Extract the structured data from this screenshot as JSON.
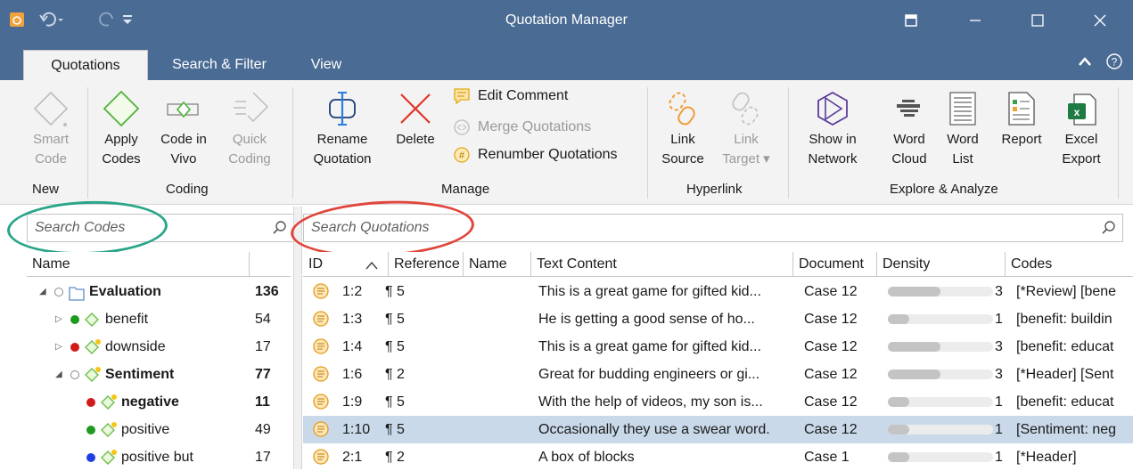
{
  "window": {
    "title": "Quotation Manager"
  },
  "tabs": [
    "Quotations",
    "Search & Filter",
    "View"
  ],
  "ribbon": {
    "new": {
      "group": "New",
      "smart_code": [
        "Smart",
        "Code"
      ]
    },
    "coding": {
      "group": "Coding",
      "apply_codes": [
        "Apply",
        "Codes"
      ],
      "code_in_vivo": [
        "Code in",
        "Vivo"
      ],
      "quick_coding": [
        "Quick",
        "Coding"
      ]
    },
    "manage": {
      "group": "Manage",
      "rename": [
        "Rename",
        "Quotation"
      ],
      "delete": "Delete",
      "edit_comment": "Edit Comment",
      "merge": "Merge Quotations",
      "renumber": "Renumber Quotations"
    },
    "hyperlink": {
      "group": "Hyperlink",
      "link_source": [
        "Link",
        "Source"
      ],
      "link_target": [
        "Link",
        "Target ▾"
      ]
    },
    "explore": {
      "group": "Explore & Analyze",
      "show_network": [
        "Show in",
        "Network"
      ],
      "word_cloud": [
        "Word",
        "Cloud"
      ],
      "word_list": [
        "Word",
        "List"
      ],
      "report": "Report",
      "excel_export": [
        "Excel",
        "Export"
      ]
    }
  },
  "search_codes": {
    "placeholder": "Search Codes"
  },
  "search_quotations": {
    "placeholder": "Search Quotations"
  },
  "codes_table": {
    "header": {
      "name": "Name"
    },
    "rows": [
      {
        "name": "Evaluation",
        "count": "136",
        "bold": true,
        "dot": "",
        "kind": "folder",
        "expander": "◢",
        "indent": 0
      },
      {
        "name": "benefit",
        "count": "54",
        "bold": false,
        "dot": "#1e9a1e",
        "kind": "code",
        "expander": "▷",
        "indent": 1
      },
      {
        "name": "downside",
        "count": "17",
        "bold": false,
        "dot": "#d11a1a",
        "kind": "code-star",
        "expander": "▷",
        "indent": 1
      },
      {
        "name": "Sentiment",
        "count": "77",
        "bold": true,
        "dot": "",
        "kind": "code-star",
        "expander": "◢",
        "indent": 1
      },
      {
        "name": "negative",
        "count": "11",
        "bold": true,
        "dot": "#d11a1a",
        "kind": "code-star",
        "expander": "",
        "indent": 2
      },
      {
        "name": "positive",
        "count": "49",
        "bold": false,
        "dot": "#1e9a1e",
        "kind": "code-star",
        "expander": "",
        "indent": 2
      },
      {
        "name": "positive but",
        "count": "17",
        "bold": false,
        "dot": "#1f3fe0",
        "kind": "code-star",
        "expander": "",
        "indent": 2
      }
    ]
  },
  "quotations_table": {
    "header": {
      "id": "ID",
      "reference": "Reference",
      "name": "Name",
      "text": "Text Content",
      "document": "Document",
      "density": "Density",
      "codes": "Codes"
    },
    "rows": [
      {
        "id": "1:2",
        "ref": "¶ 5",
        "text": "This is a great game for gifted kid...",
        "doc": "Case 12",
        "density": 3,
        "codes": "[*Review] [bene"
      },
      {
        "id": "1:3",
        "ref": "¶ 5",
        "text": "He is getting a good sense of ho...",
        "doc": "Case 12",
        "density": 1,
        "codes": "[benefit: buildin"
      },
      {
        "id": "1:4",
        "ref": "¶ 5",
        "text": "This is a great game for gifted kid...",
        "doc": "Case 12",
        "density": 3,
        "codes": "[benefit: educat"
      },
      {
        "id": "1:6",
        "ref": "¶ 2",
        "text": "Great for budding engineers or gi...",
        "doc": "Case 12",
        "density": 3,
        "codes": "[*Header] [Sent"
      },
      {
        "id": "1:9",
        "ref": "¶ 5",
        "text": "With the help of videos, my son is...",
        "doc": "Case 12",
        "density": 1,
        "codes": "[benefit: educat"
      },
      {
        "id": "1:10",
        "ref": "¶ 5",
        "text": "Occasionally they use a swear word.",
        "doc": "Case 12",
        "density": 1,
        "codes": "[Sentiment: neg",
        "selected": true
      },
      {
        "id": "2:1",
        "ref": "¶ 2",
        "text": "A box of blocks",
        "doc": "Case 1",
        "density": 1,
        "codes": "[*Header]"
      }
    ]
  },
  "colors": {
    "titlebar": "#4a6b93",
    "accent_green": "#2aa58a",
    "accent_red": "#e0463c",
    "selection": "#c9d9ea"
  }
}
